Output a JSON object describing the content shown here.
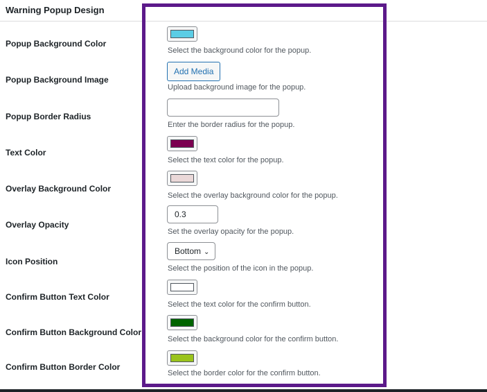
{
  "section": {
    "title": "Warning Popup Design"
  },
  "rows": [
    {
      "label": "Popup Background Color",
      "description": "Select the background color for the popup.",
      "swatch_color": "#5bcde5"
    },
    {
      "label": "Popup Background Image",
      "description": "Upload background image for the popup.",
      "button_label": "Add Media"
    },
    {
      "label": "Popup Border Radius",
      "description": "Enter the border radius for the popup.",
      "value": ""
    },
    {
      "label": "Text Color",
      "description": "Select the text color for the popup.",
      "swatch_color": "#7b0050"
    },
    {
      "label": "Overlay Background Color",
      "description": "Select the overlay background color for the popup.",
      "swatch_color": "#ead8d8"
    },
    {
      "label": "Overlay Opacity",
      "description": "Set the overlay opacity for the popup.",
      "value": "0.3"
    },
    {
      "label": "Icon Position",
      "description": "Select the position of the icon in the popup.",
      "selected": "Bottom"
    },
    {
      "label": "Confirm Button Text Color",
      "description": "Select the text color for the confirm button.",
      "swatch_color": "#ffffff"
    },
    {
      "label": "Confirm Button Background Color",
      "description": "Select the background color for the confirm button.",
      "swatch_color": "#006400"
    },
    {
      "label": "Confirm Button Border Color",
      "description": "Select the border color for the confirm button.",
      "swatch_color": "#9ac31c"
    }
  ],
  "colors": {
    "highlight_border": "#5c1a8a",
    "accent": "#2271b1"
  }
}
